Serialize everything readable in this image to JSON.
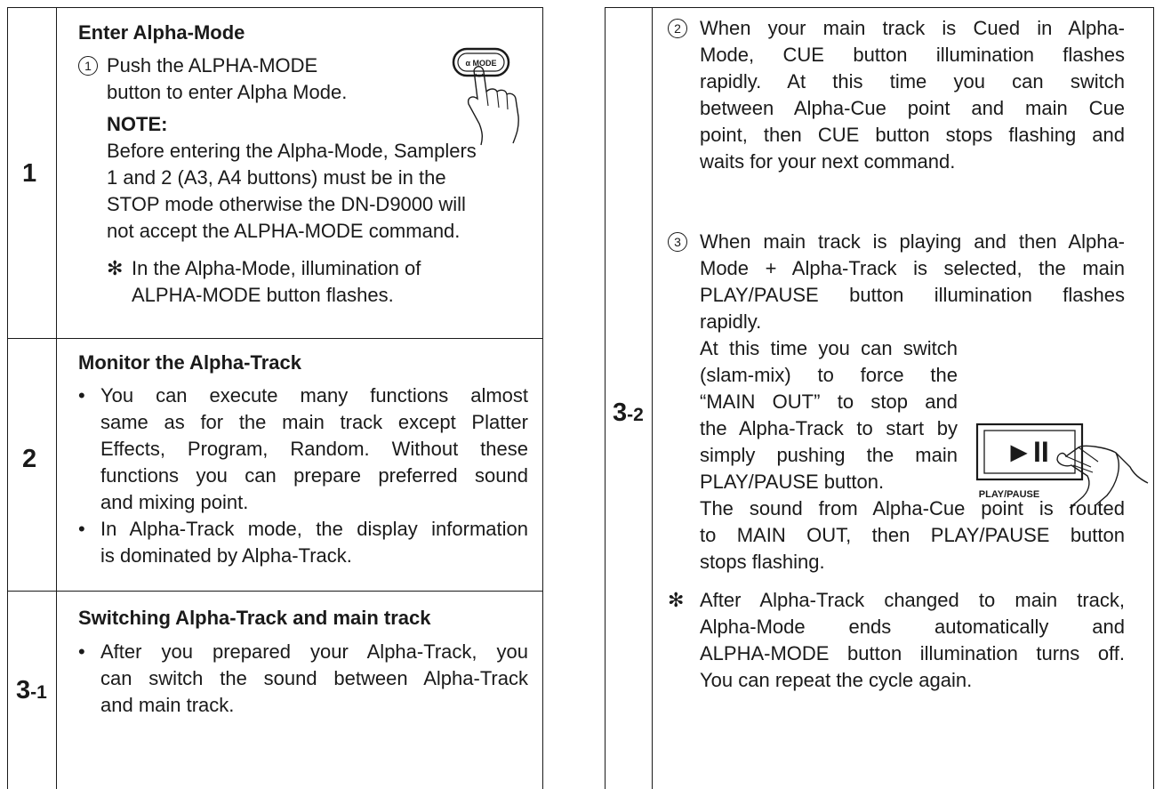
{
  "left": {
    "s1": {
      "num": "1",
      "heading": "Enter Alpha-Mode",
      "step_mark": "1",
      "step_line1": "Push the ALPHA-MODE",
      "step_line2": "button to enter Alpha Mode.",
      "note_label": "NOTE:",
      "note_lines": [
        "Before entering the Alpha-Mode, Samplers",
        "1 and 2 (A3, A4 buttons) must be in the",
        "STOP mode otherwise the DN-D9000 will",
        "not accept the ALPHA-MODE command."
      ],
      "star": "✻",
      "star_line1": "In the Alpha-Mode, illumination of",
      "star_line2": "ALPHA-MODE button flashes.",
      "button_label": "α MODE"
    },
    "s2": {
      "num": "2",
      "heading": "Monitor the Alpha-Track",
      "bullet": "•",
      "b1_lines": [
        "You can execute many functions almost",
        "same as for the main track except Platter",
        "Effects, Program, Random. Without these",
        "functions you can prepare preferred sound",
        "and mixing point."
      ],
      "b2_lines": [
        "In Alpha-Track mode, the display information",
        "is dominated by Alpha-Track."
      ]
    },
    "s31": {
      "num": "3",
      "num_suffix": "-1",
      "heading": "Switching Alpha-Track and main track",
      "bullet": "•",
      "b1_lines": [
        "After you prepared your Alpha-Track, you",
        "can switch the sound between Alpha-Track",
        "and main track."
      ]
    }
  },
  "right": {
    "num": "3",
    "num_suffix": "-2",
    "i2_mark": "2",
    "i2_lines": [
      "When your main track is Cued in Alpha-",
      "Mode, CUE button illumination flashes",
      "rapidly. At this time you can switch",
      "between Alpha-Cue point and main Cue",
      "point, then CUE button stops flashing and",
      "waits for your next command."
    ],
    "i3_mark": "3",
    "i3_lines": [
      "When main track is playing and then Alpha-",
      "Mode + Alpha-Track is selected, the main",
      "PLAY/PAUSE button illumination flashes",
      "rapidly."
    ],
    "i3_wrap_lines": [
      "At this time you can switch",
      "(slam-mix) to force the",
      "“MAIN OUT” to stop and",
      "the Alpha-Track to start by",
      "simply pushing the main",
      "PLAY/PAUSE button."
    ],
    "i3_after_lines": [
      "The sound from Alpha-Cue point is routed",
      "to MAIN OUT, then PLAY/PAUSE button",
      "stops flashing."
    ],
    "star": "✻",
    "star_lines": [
      "After Alpha-Track changed to main track,",
      "Alpha-Mode ends automatically and",
      "ALPHA-MODE button illumination turns off.",
      "You can repeat the cycle again."
    ],
    "play_symbol": "►II",
    "play_label": "PLAY/PAUSE"
  }
}
